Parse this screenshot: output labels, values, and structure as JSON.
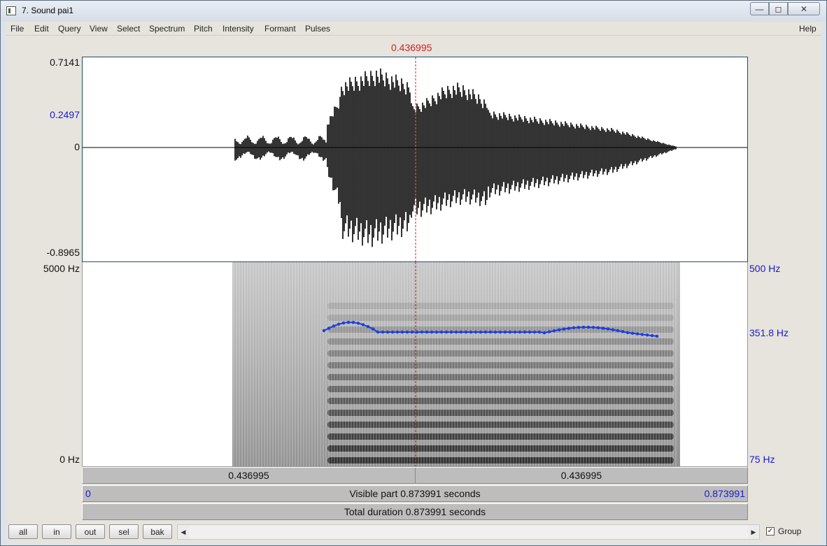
{
  "window": {
    "title": "7. Sound pai1",
    "min_glyph": "—",
    "max_glyph": "◻",
    "close_glyph": "✕"
  },
  "menu": {
    "items": [
      "File",
      "Edit",
      "Query",
      "View",
      "Select",
      "Spectrum",
      "Pitch",
      "Intensity",
      "Formant",
      "Pulses"
    ],
    "help": "Help"
  },
  "cursor": {
    "time_label": "0.436995",
    "color": "#d42020"
  },
  "waveform": {
    "max_label": "0.7141",
    "value_label": "0.2497",
    "zero_label": "0",
    "min_label": "-0.8965"
  },
  "spectrogram": {
    "top_label": "5000 Hz",
    "bottom_label": "0 Hz"
  },
  "pitch": {
    "top_label": "500 Hz",
    "value_label": "351.8 Hz",
    "bottom_label": "75 Hz",
    "color": "#1a3ee0"
  },
  "bars": {
    "left_time": "0.436995",
    "right_time": "0.436995",
    "visible_start": "0",
    "visible_label": "Visible part 0.873991 seconds",
    "visible_end": "0.873991",
    "total_label": "Total duration 0.873991 seconds"
  },
  "toolbar": {
    "all": "all",
    "in": "in",
    "out": "out",
    "sel": "sel",
    "bak": "bak",
    "scroll_left": "◀",
    "scroll_right": "▶",
    "group_check": "✓",
    "group_label": "Group"
  }
}
